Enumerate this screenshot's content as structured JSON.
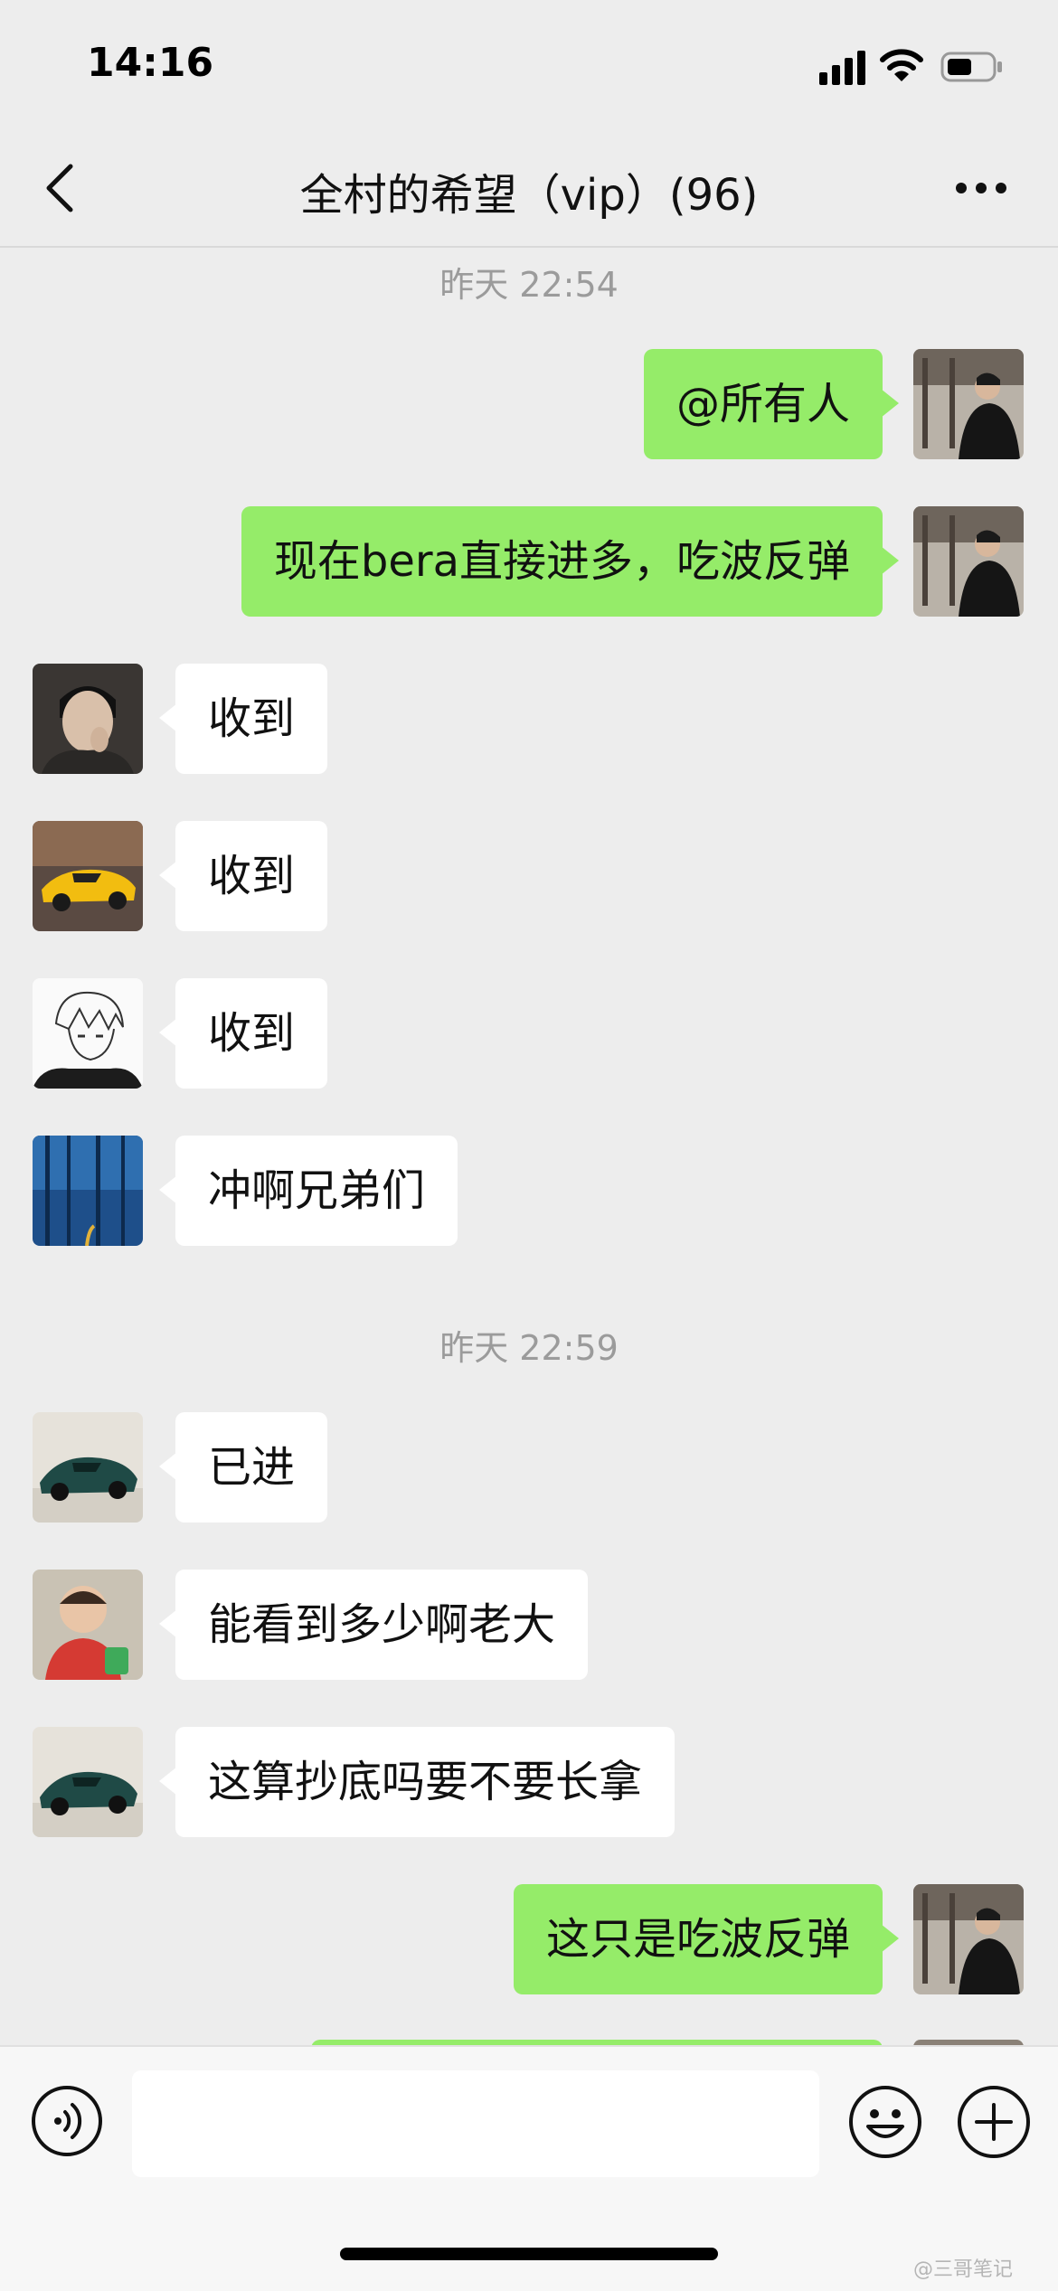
{
  "status_bar": {
    "time": "14:16"
  },
  "nav": {
    "title": "全村的希望（vip）(96)"
  },
  "timestamps": [
    "昨天 22:54",
    "昨天 22:59"
  ],
  "messages": [
    {
      "from": "me",
      "text": "@所有人",
      "avatar": "man-in-black-sweater-avatar"
    },
    {
      "from": "me",
      "text": "现在bera直接进多，吃波反弹",
      "avatar": "man-in-black-sweater-avatar"
    },
    {
      "from": "other",
      "text": "收到",
      "avatar": "young-man-portrait-avatar"
    },
    {
      "from": "other",
      "text": "收到",
      "avatar": "yellow-sports-car-avatar"
    },
    {
      "from": "other",
      "text": "收到",
      "avatar": "anime-sketch-avatar"
    },
    {
      "from": "other",
      "text": "冲啊兄弟们",
      "avatar": "blue-forest-avatar"
    },
    {
      "from": "other",
      "text": "已进",
      "avatar": "green-sports-car-avatar"
    },
    {
      "from": "other",
      "text": "能看到多少啊老大",
      "avatar": "baby-photo-avatar"
    },
    {
      "from": "other",
      "text": "这算抄底吗要不要长拿",
      "avatar": "green-sports-car-avatar"
    },
    {
      "from": "me",
      "text": "这只是吃波反弹",
      "avatar": "man-in-black-sweater-avatar"
    }
  ],
  "input": {
    "value": ""
  },
  "watermark": "@三哥笔记",
  "colors": {
    "background": "#ededed",
    "my_bubble": "#95ec69",
    "other_bubble": "#ffffff"
  }
}
